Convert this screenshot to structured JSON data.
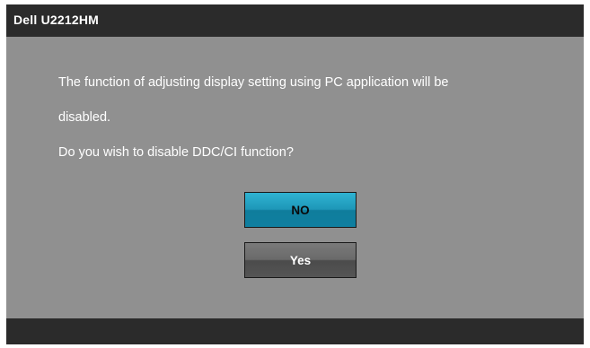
{
  "window": {
    "title": "Dell U2212HM"
  },
  "message": {
    "line1": "The function of adjusting display setting using PC application will be",
    "line2": "disabled.",
    "line3": "Do you wish to disable DDC/CI function?"
  },
  "buttons": {
    "no_label": "NO",
    "yes_label": "Yes",
    "selected": "NO"
  },
  "colors": {
    "title_bar": "#2b2b2b",
    "body_background": "#909090",
    "selected_button": "#1e97b8",
    "unselected_button": "#6a6a6a",
    "text": "#ffffff"
  }
}
